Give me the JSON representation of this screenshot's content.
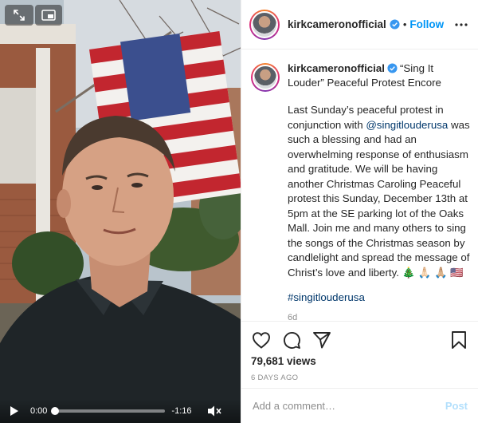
{
  "post": {
    "username": "kirkcameronofficial",
    "follow_label": "Follow",
    "separator": "•"
  },
  "caption": {
    "title_text": "“Sing It Louder” Peaceful Protest Encore",
    "body_part1": "Last Sunday’s peaceful protest in conjunction with ",
    "mention": "@singitlouderusa",
    "body_part2": " was such a blessing and had an overwhelming response of enthusiasm and gratitude. We will be having another Christmas Caroling Peaceful protest this Sunday, December 13th at 5pm at the SE parking lot of the Oaks Mall. Join me and many others to sing the songs of the Christmas season by candlelight and spread the message of Christ’s love and liberty. 🎄 🙏🏻 🙏🏼 🇺🇸",
    "hashtag": "#singitlouderusa",
    "age": "6d"
  },
  "video": {
    "current_time": "0:00",
    "remaining_time": "-1:16",
    "progress": 0
  },
  "stats": {
    "views": "79,681 views",
    "posted": "6 DAYS AGO"
  },
  "comment": {
    "placeholder": "Add a comment…",
    "post_label": "Post"
  },
  "icons": {
    "verified": "verified-badge-icon",
    "more": "more-options-icon",
    "like": "heart-icon",
    "comment": "comment-bubble-icon",
    "share": "paper-plane-icon",
    "save": "bookmark-icon",
    "expand": "fullscreen-icon",
    "pip": "picture-in-picture-icon",
    "play": "play-icon",
    "mute": "speaker-muted-icon"
  },
  "colors": {
    "link": "#0095f6",
    "mention": "#00376b",
    "muted": "#8e8e8e",
    "post_disabled": "#b2dffc"
  }
}
